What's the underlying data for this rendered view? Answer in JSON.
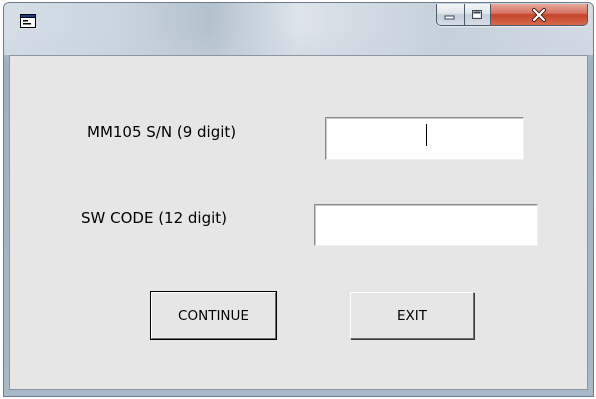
{
  "window": {
    "icon": "app-window-icon",
    "caption_buttons": {
      "minimize": "minimize-icon",
      "maximize": "maximize-icon",
      "close": "close-icon"
    }
  },
  "form": {
    "serial_label": "MM105 S/N (9 digit)",
    "serial_value": "",
    "sw_code_label": "SW CODE (12 digit)",
    "sw_code_value": ""
  },
  "buttons": {
    "continue": "CONTINUE",
    "exit": "EXIT"
  },
  "colors": {
    "client_background": "#e6e6e6",
    "close_button": "#c4442b"
  }
}
